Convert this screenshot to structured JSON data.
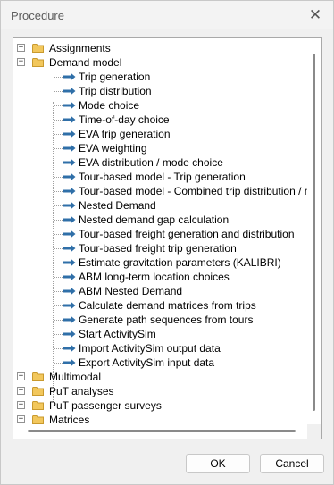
{
  "window": {
    "title": "Procedure",
    "close_glyph": "✕"
  },
  "tree": {
    "colors": {
      "folder_fill": "#f2c75c",
      "folder_edge": "#c99a2e",
      "arrow": "#2f6fa8"
    },
    "items_before": [
      {
        "label": "Assignments",
        "expander": "+"
      },
      {
        "label": "Demand model",
        "expander": "−"
      }
    ],
    "children": [
      "Trip generation",
      "Trip distribution",
      "Mode choice",
      "Time-of-day choice",
      "EVA trip generation",
      "EVA weighting",
      "EVA distribution / mode choice",
      "Tour-based model - Trip generation",
      "Tour-based model - Combined trip distribution / mode choice",
      "Nested Demand",
      "Nested demand gap calculation",
      "Tour-based freight generation and distribution",
      "Tour-based freight trip generation",
      "Estimate gravitation parameters (KALIBRI)",
      "ABM long-term location choices",
      "ABM Nested Demand",
      "Calculate demand matrices from trips",
      "Generate path sequences from tours",
      "Start ActivitySim",
      "Import ActivitySim output data",
      "Export ActivitySim input data"
    ],
    "items_after": [
      {
        "label": "Multimodal",
        "expander": "+"
      },
      {
        "label": "PuT analyses",
        "expander": "+"
      },
      {
        "label": "PuT passenger surveys",
        "expander": "+"
      },
      {
        "label": "Matrices",
        "expander": "+"
      }
    ]
  },
  "buttons": {
    "ok": "OK",
    "cancel": "Cancel"
  }
}
